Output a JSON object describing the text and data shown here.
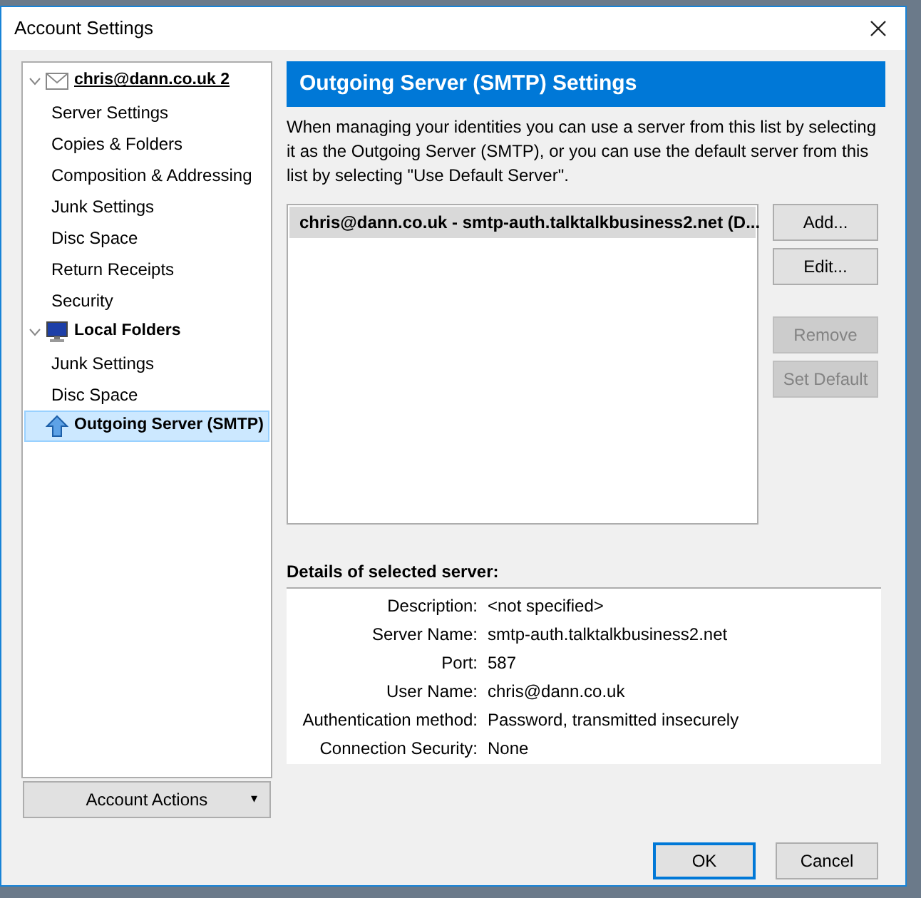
{
  "window": {
    "title": "Account Settings"
  },
  "tree": [
    {
      "label": "chris@dann.co.uk 2",
      "kind": "mail",
      "expanded": true,
      "selected": false,
      "children": [
        {
          "label": "Server Settings",
          "selected": false
        },
        {
          "label": "Copies & Folders",
          "selected": false
        },
        {
          "label": "Composition & Addressing",
          "selected": false
        },
        {
          "label": "Junk Settings",
          "selected": false
        },
        {
          "label": "Disc Space",
          "selected": false
        },
        {
          "label": "Return Receipts",
          "selected": false
        },
        {
          "label": "Security",
          "selected": false
        }
      ]
    },
    {
      "label": "Local Folders",
      "kind": "local",
      "expanded": true,
      "selected": false,
      "children": [
        {
          "label": "Junk Settings",
          "selected": false
        },
        {
          "label": "Disc Space",
          "selected": false
        }
      ]
    },
    {
      "label": "Outgoing Server (SMTP)",
      "kind": "smtp",
      "selected": true
    }
  ],
  "account_actions": {
    "label": "Account Actions",
    "arrow": "▾"
  },
  "panel": {
    "title": "Outgoing Server (SMTP) Settings",
    "description": "When managing your identities you can use a server from this list by selecting it as the Outgoing Server (SMTP), or you can use the default server from this list by selecting \"Use Default Server\".",
    "servers": [
      {
        "label": "chris@dann.co.uk - smtp-auth.talktalkbusiness2.net (D...",
        "selected": true
      }
    ],
    "buttons": [
      {
        "label": "Add...",
        "disabled": false
      },
      {
        "label": "Edit...",
        "disabled": false
      },
      {
        "label": "Remove",
        "disabled": true
      },
      {
        "label": "Set Default",
        "disabled": true
      }
    ],
    "details_title": "Details of selected server:",
    "details": [
      {
        "label": "Description:",
        "value": "<not specified>"
      },
      {
        "label": "Server Name:",
        "value": "smtp-auth.talktalkbusiness2.net"
      },
      {
        "label": "Port:",
        "value": "587"
      },
      {
        "label": "User Name:",
        "value": "chris@dann.co.uk"
      },
      {
        "label": "Authentication method:",
        "value": "Password, transmitted insecurely"
      },
      {
        "label": "Connection Security:",
        "value": "None"
      }
    ]
  },
  "dialog_buttons": [
    {
      "label": "OK",
      "default": true
    },
    {
      "label": "Cancel",
      "default": false
    }
  ]
}
